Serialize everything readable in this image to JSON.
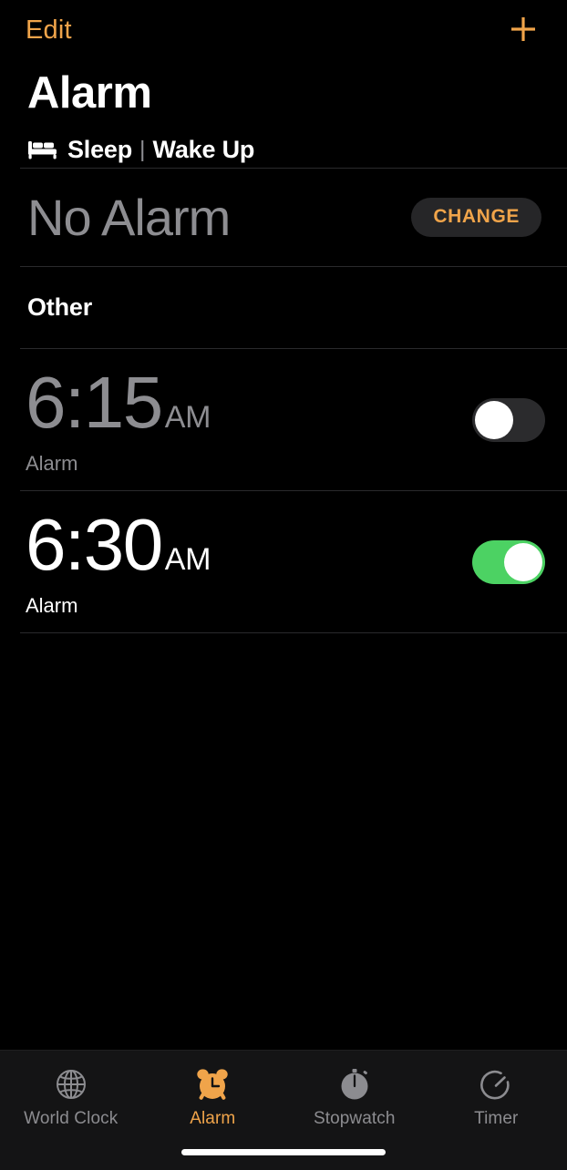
{
  "navbar": {
    "edit_label": "Edit",
    "add_icon": "plus-icon",
    "accent_color": "#f0a44a"
  },
  "page_title": "Alarm",
  "sleep_section": {
    "bed_icon": "bed-icon",
    "sleep_label": "Sleep",
    "divider": "|",
    "wake_label": "Wake Up",
    "value_text": "No Alarm",
    "change_button_label": "CHANGE"
  },
  "other_section": {
    "header": "Other",
    "alarms": [
      {
        "time": "6:15",
        "period": "AM",
        "label": "Alarm",
        "enabled": false,
        "toggle_name": "alarm-toggle-615"
      },
      {
        "time": "6:30",
        "period": "AM",
        "label": "Alarm",
        "enabled": true,
        "toggle_name": "alarm-toggle-630"
      }
    ]
  },
  "tabbar": {
    "active_index": 1,
    "tabs": [
      {
        "label": "World Clock",
        "icon": "globe-icon"
      },
      {
        "label": "Alarm",
        "icon": "alarm-clock-icon"
      },
      {
        "label": "Stopwatch",
        "icon": "stopwatch-icon"
      },
      {
        "label": "Timer",
        "icon": "timer-icon"
      }
    ],
    "inactive_color": "#8c8c90",
    "active_color": "#f0a44a"
  },
  "colors": {
    "background": "#000000",
    "toggle_on": "#4cd263",
    "toggle_off": "#2b2b2d",
    "separator": "#2a2a2c",
    "secondary_text": "#8d8d91"
  }
}
